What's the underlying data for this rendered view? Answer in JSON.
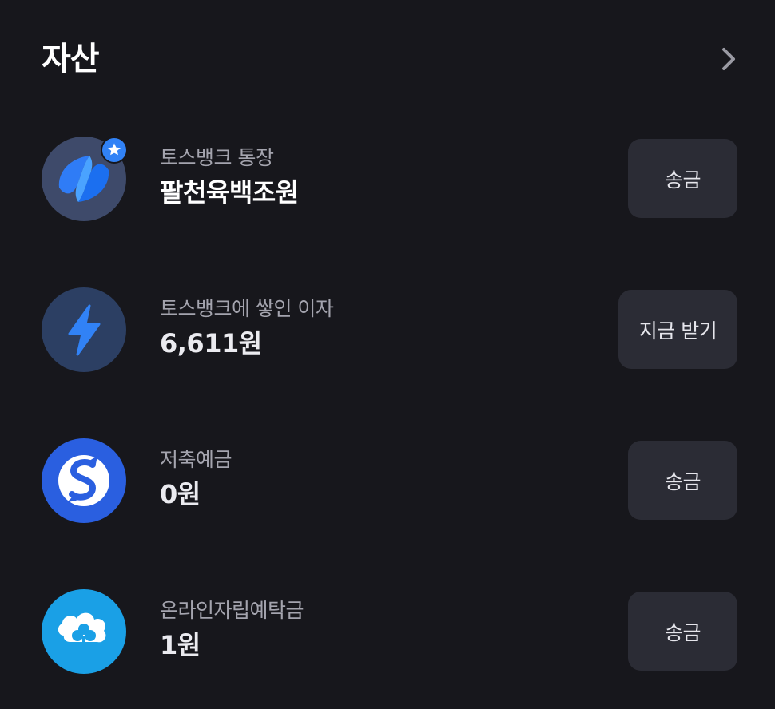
{
  "header": {
    "title": "자산"
  },
  "accounts": [
    {
      "label": "토스뱅크 통장",
      "amount": "팔천육백조원",
      "action_label": "송금",
      "icon": "toss-bank-logo-icon",
      "badge_icon": "star-icon"
    },
    {
      "label": "토스뱅크에 쌓인 이자",
      "amount": "6,611원",
      "action_label": "지금 받기",
      "icon": "lightning-bolt-icon"
    },
    {
      "label": "저축예금",
      "amount": "0원",
      "action_label": "송금",
      "icon": "shinhan-bank-logo-icon"
    },
    {
      "label": "온라인자립예탁금",
      "amount": "1원",
      "action_label": "송금",
      "icon": "cloud-clover-logo-icon"
    }
  ],
  "colors": {
    "background": "#17171c",
    "button_background": "#2b2c35",
    "label_text": "#a4a4ae",
    "toss_blue": "#3182f6",
    "shinhan_blue": "#2a5fe0",
    "cloud_blue": "#1aa0e6"
  }
}
